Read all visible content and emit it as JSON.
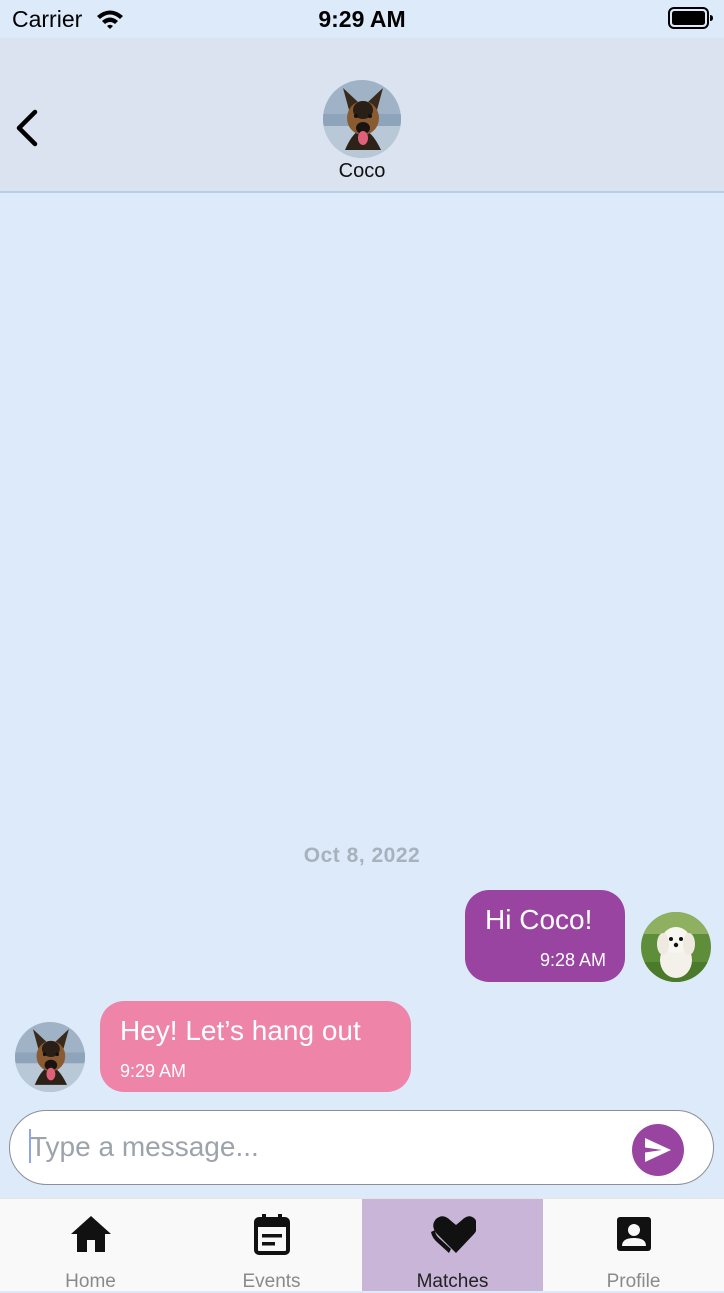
{
  "status_bar": {
    "carrier": "Carrier",
    "time": "9:29 AM",
    "wifi_icon": "wifi-icon",
    "battery_icon": "battery-full-icon"
  },
  "header": {
    "back_icon": "chevron-left-icon",
    "contact_name": "Coco",
    "contact_avatar": "german-shepherd-photo"
  },
  "conversation": {
    "date_label": "Oct 8, 2022",
    "messages": [
      {
        "direction": "outgoing",
        "text": "Hi Coco!",
        "time": "9:28 AM",
        "bubble_color": "#9a44a2",
        "avatar": "white-maltese-photo"
      },
      {
        "direction": "incoming",
        "text": "Hey! Let’s hang out",
        "time": "9:29 AM",
        "bubble_color": "#ee84a8",
        "avatar": "german-shepherd-photo"
      }
    ]
  },
  "composer": {
    "placeholder": "Type a message...",
    "value": "",
    "send_icon": "send-icon",
    "send_button_color": "#9a44a2"
  },
  "bottom_nav": {
    "active_index": 2,
    "active_color": "#c8b5d8",
    "items": [
      {
        "label": "Home",
        "icon": "home-icon"
      },
      {
        "label": "Events",
        "icon": "event-note-icon"
      },
      {
        "label": "Matches",
        "icon": "heart-icon"
      },
      {
        "label": "Profile",
        "icon": "account-box-icon"
      }
    ]
  },
  "colors": {
    "background": "#dceafa",
    "header_background": "#dae3ef"
  }
}
